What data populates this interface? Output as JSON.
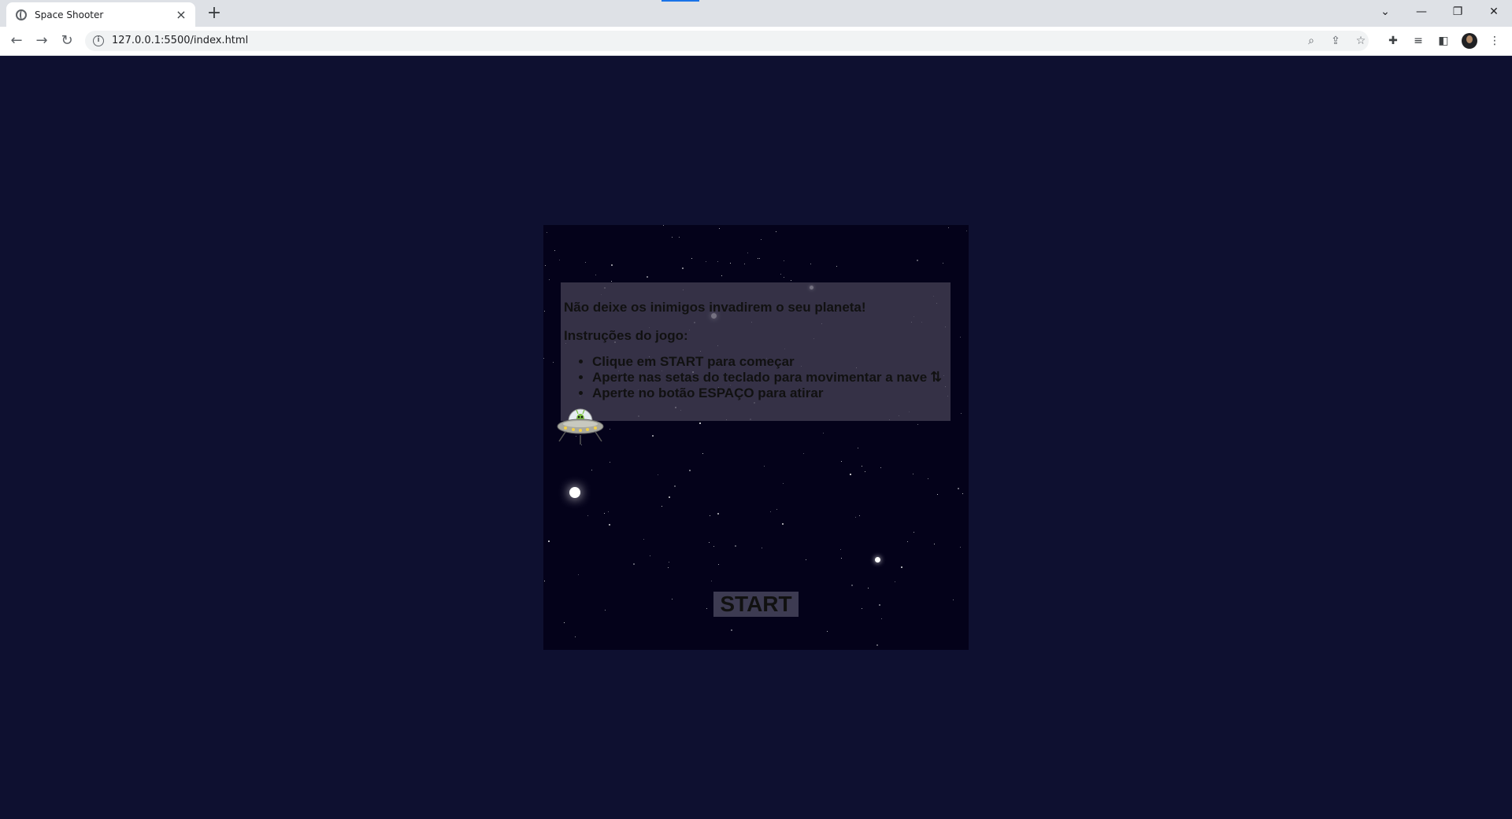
{
  "browser": {
    "tab_title": "Space Shooter",
    "tab_close": "×",
    "new_tab": "+",
    "url": "127.0.0.1:5500/index.html"
  },
  "game": {
    "headline": "Não deixe os inimigos invadirem o seu planeta!",
    "instructions_title": "Instruções do jogo:",
    "instructions": [
      "Clique em START para começar",
      "Aperte nas setas do teclado para movimentar a nave",
      "Aperte no botão ESPAÇO para atirar"
    ],
    "arrows_icon": "up-down-arrows-icon",
    "start_label": "START"
  },
  "colors": {
    "page_background": "#0e1030",
    "game_background": "#04021a",
    "panel_background": "#464256",
    "start_button": "#3d3b52"
  }
}
